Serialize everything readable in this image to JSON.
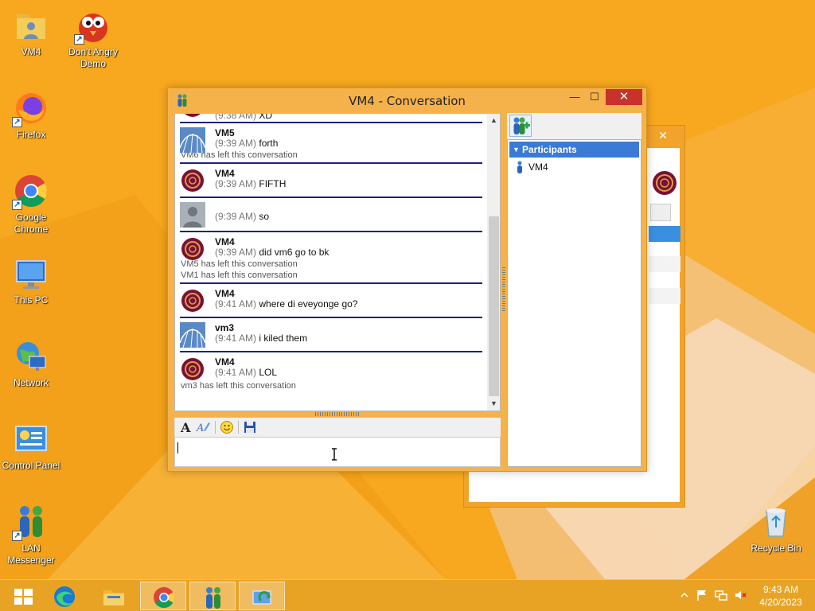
{
  "desktop": {
    "icons": [
      {
        "label": "VM4"
      },
      {
        "label": "Don't Angry Demo"
      },
      {
        "label": "Firefox"
      },
      {
        "label": "Google Chrome"
      },
      {
        "label": "This PC"
      },
      {
        "label": "Network"
      },
      {
        "label": "Control Panel"
      },
      {
        "label": "LAN Messenger"
      },
      {
        "label": "Recycle Bin"
      }
    ]
  },
  "window": {
    "title": "VM4 - Conversation",
    "minimize": "—",
    "maximize": "☐",
    "close": "✕"
  },
  "background_window": {
    "close": "✕"
  },
  "chat": {
    "first_partial": {
      "time": "(9:38 AM)",
      "text": "XD"
    },
    "messages": [
      {
        "sender": "VM5",
        "time": "(9:39 AM)",
        "text": "forth",
        "avatar": "coaster"
      },
      {
        "system": "VM6 has left this conversation"
      },
      {
        "sender": "VM4",
        "time": "(9:39 AM)",
        "text": "FIFTH",
        "avatar": "ball"
      },
      {
        "sender": "",
        "time": "(9:39 AM)",
        "text": "so",
        "avatar": "person"
      },
      {
        "sender": "VM4",
        "time": "(9:39 AM)",
        "text": "did vm6 go to bk",
        "avatar": "ball"
      },
      {
        "system": "VM5 has left this conversation"
      },
      {
        "system": "VM1 has left this conversation"
      },
      {
        "sender": "VM4",
        "time": "(9:41 AM)",
        "text": "where di eveyonge go?",
        "avatar": "ball"
      },
      {
        "sender": "vm3",
        "time": "(9:41 AM)",
        "text": "i kiled them",
        "avatar": "coaster"
      },
      {
        "sender": "VM4",
        "time": "(9:41 AM)",
        "text": "LOL",
        "avatar": "ball"
      },
      {
        "system": "vm3 has left this conversation"
      }
    ],
    "scroll_up": "▲",
    "scroll_down": "▼"
  },
  "input": {
    "value": ""
  },
  "participants": {
    "header": "Participants",
    "items": [
      {
        "name": "VM4"
      }
    ]
  },
  "taskbar": {
    "items": [
      "start",
      "edge",
      "file-explorer",
      "chrome",
      "lan-messenger",
      "network-tool"
    ],
    "clock_time": "9:43 AM",
    "clock_date": "4/20/2023"
  },
  "colors": {
    "accent": "#3a7bd5",
    "separator": "#1a237e",
    "close_red": "#c7322a",
    "desktop": "#f6a41c"
  }
}
